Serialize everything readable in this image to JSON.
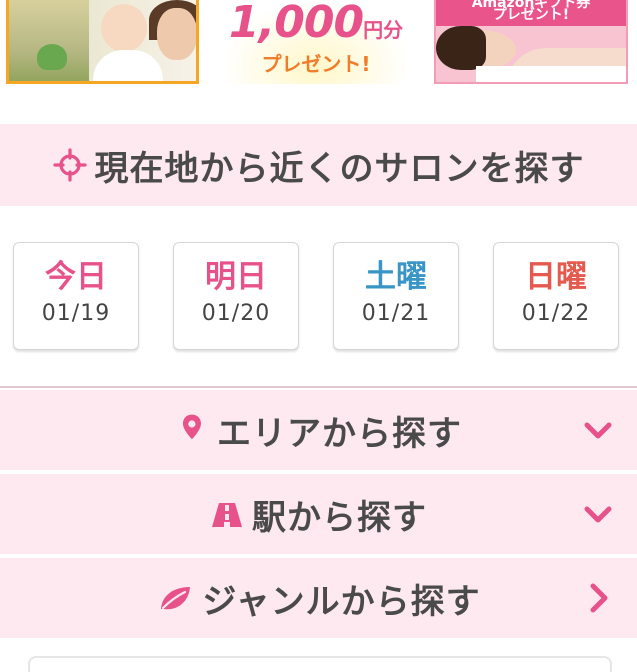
{
  "banners": {
    "gift": {
      "amount": "1,000",
      "unit": "円分",
      "present": "プレゼント!"
    },
    "spa": {
      "ribbon_line1": "Amazonギフト券",
      "ribbon_line2": "プレゼント!"
    }
  },
  "locate": {
    "label": "現在地から近くのサロンを探す",
    "icon": "crosshair-icon"
  },
  "dates": [
    {
      "day": "今日",
      "date": "01/19",
      "color": "#e8528a"
    },
    {
      "day": "明日",
      "date": "01/20",
      "color": "#e8528a"
    },
    {
      "day": "土曜",
      "date": "01/21",
      "color": "#3a95c7"
    },
    {
      "day": "日曜",
      "date": "01/22",
      "color": "#e5594e"
    }
  ],
  "search": {
    "area": {
      "label": "エリアから探す",
      "icon": "map-pin-icon",
      "action": "chevron-down-icon"
    },
    "station": {
      "label": "駅から探す",
      "icon": "train-icon",
      "action": "chevron-down-icon"
    },
    "genre": {
      "label": "ジャンルから探す",
      "icon": "leaf-icon",
      "action": "chevron-right-icon"
    }
  },
  "colors": {
    "accent": "#e8528a",
    "row_bg": "#fde9ef"
  }
}
